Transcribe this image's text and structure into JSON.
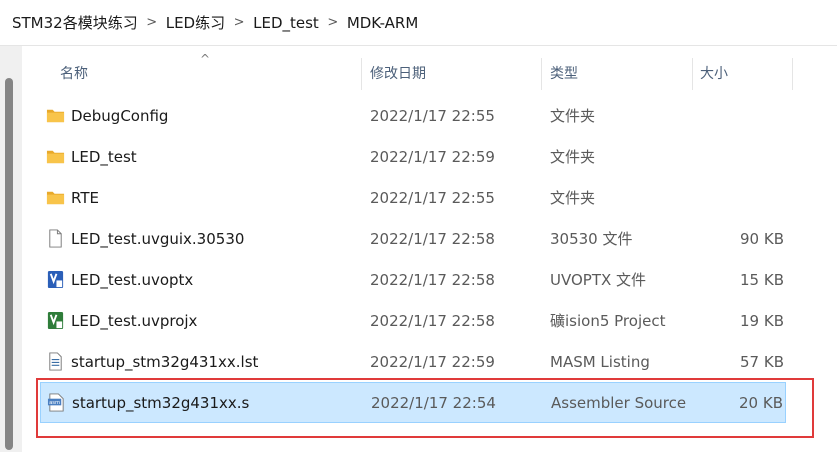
{
  "breadcrumb": [
    "STM32各模块练习",
    "LED练习",
    "LED_test",
    "MDK-ARM"
  ],
  "breadcrumb_separator": ">",
  "columns": {
    "name": "名称",
    "date": "修改日期",
    "type": "类型",
    "size": "大小"
  },
  "sort_indicator": "^",
  "files": [
    {
      "name": "DebugConfig",
      "date": "2022/1/17 22:55",
      "type": "文件夹",
      "size": "",
      "icon": "folder-icon"
    },
    {
      "name": "LED_test",
      "date": "2022/1/17 22:59",
      "type": "文件夹",
      "size": "",
      "icon": "folder-icon"
    },
    {
      "name": "RTE",
      "date": "2022/1/17 22:55",
      "type": "文件夹",
      "size": "",
      "icon": "folder-icon"
    },
    {
      "name": "LED_test.uvguix.30530",
      "date": "2022/1/17 22:58",
      "type": "30530 文件",
      "size": "90 KB",
      "icon": "generic-file-icon"
    },
    {
      "name": "LED_test.uvoptx",
      "date": "2022/1/17 22:58",
      "type": "UVOPTX 文件",
      "size": "15 KB",
      "icon": "uvision-options-icon"
    },
    {
      "name": "LED_test.uvprojx",
      "date": "2022/1/17 22:58",
      "type": "礦ision5 Project",
      "size": "19 KB",
      "icon": "uvision-project-icon"
    },
    {
      "name": "startup_stm32g431xx.lst",
      "date": "2022/1/17 22:59",
      "type": "MASM Listing",
      "size": "57 KB",
      "icon": "listing-file-icon"
    },
    {
      "name": "startup_stm32g431xx.s",
      "date": "2022/1/17 22:54",
      "type": "Assembler Source",
      "size": "20 KB",
      "icon": "asm-file-icon",
      "selected": true
    }
  ],
  "asm_icon_text": "asm",
  "colors": {
    "selection_bg": "#cce8ff",
    "selection_border": "#99d1ff",
    "highlight_box": "#e03a3a",
    "folder": "#f8c44a"
  }
}
